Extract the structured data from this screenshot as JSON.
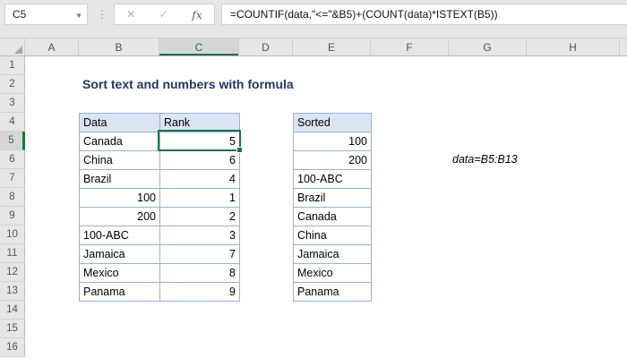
{
  "name_box": {
    "value": "C5",
    "dropdown_icon": "▼"
  },
  "formula_bar": {
    "separator_dots": "⋮",
    "cancel": "✕",
    "confirm": "✓",
    "fx": "fx",
    "formula": "=COUNTIF(data,\"<=\"&B5)+(COUNT(data)*ISTEXT(B5))"
  },
  "column_headers": [
    "A",
    "B",
    "C",
    "D",
    "E",
    "F",
    "G",
    "H"
  ],
  "row_headers": [
    "1",
    "2",
    "3",
    "4",
    "5",
    "6",
    "7",
    "8",
    "9",
    "10",
    "11",
    "12",
    "13",
    "14",
    "15",
    "16"
  ],
  "selection": {
    "active_cell": "C5",
    "selected_column": "C",
    "selected_row": "5",
    "active_value": "5"
  },
  "sheet": {
    "title": "Sort text and numbers with formula",
    "note": "data=B5:B13",
    "data_table": {
      "headers": [
        "Data",
        "Rank"
      ],
      "rows": [
        [
          "Canada",
          "5"
        ],
        [
          "China",
          "6"
        ],
        [
          "Brazil",
          "4"
        ],
        [
          "100",
          "1"
        ],
        [
          "200",
          "2"
        ],
        [
          "100-ABC",
          "3"
        ],
        [
          "Jamaica",
          "7"
        ],
        [
          "Mexico",
          "8"
        ],
        [
          "Panama",
          "9"
        ]
      ]
    },
    "sorted_table": {
      "header": "Sorted",
      "rows": [
        "100",
        "200",
        "100-ABC",
        "Brazil",
        "Canada",
        "China",
        "Jamaica",
        "Mexico",
        "Panama"
      ]
    }
  },
  "colors": {
    "excel_green": "#217346",
    "header_underline_green": "#107c41",
    "table_border": "#95b3d7",
    "table_header_fill": "#dbe5f1",
    "title_color": "#1f3864",
    "chrome_bg": "#e6e6e6"
  }
}
